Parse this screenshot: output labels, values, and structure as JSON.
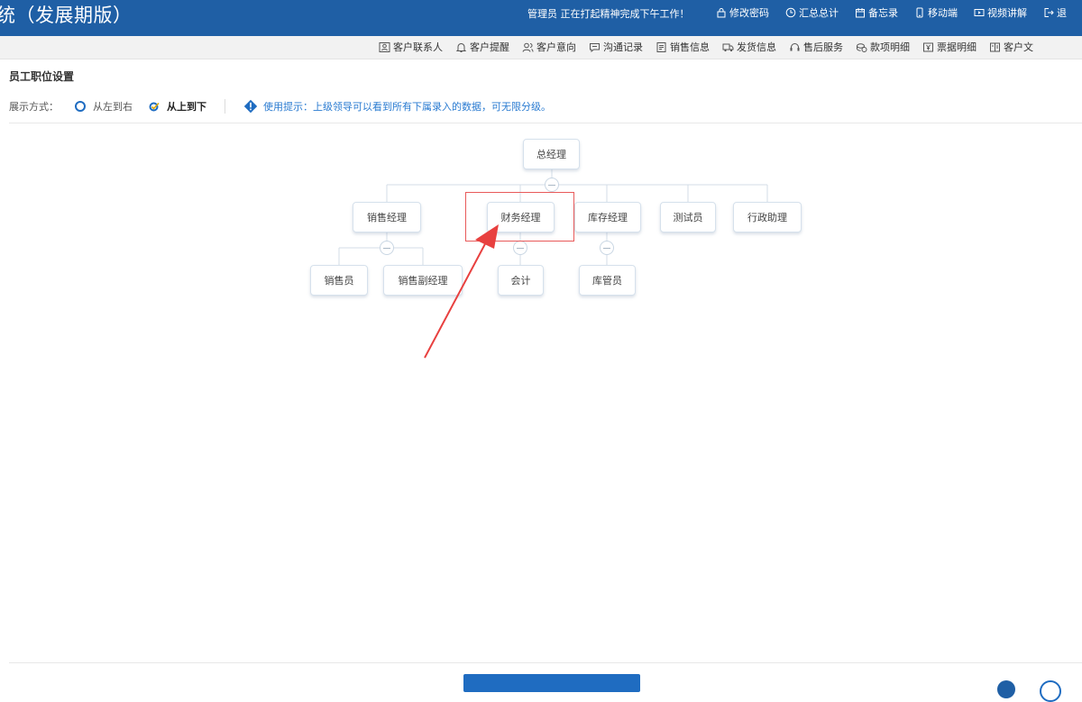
{
  "header": {
    "app_title": "统（发展期版）",
    "greeting": "管理员 正在打起精神完成下午工作！",
    "links": [
      {
        "label": "修改密码",
        "icon": "lock-icon"
      },
      {
        "label": "汇总总计",
        "icon": "clock-icon"
      },
      {
        "label": "备忘录",
        "icon": "calendar-icon"
      },
      {
        "label": "移动端",
        "icon": "mobile-icon"
      },
      {
        "label": "视频讲解",
        "icon": "video-icon"
      },
      {
        "label": "退",
        "icon": "logout-icon"
      }
    ]
  },
  "nav": {
    "items": [
      {
        "label": "客户联系人",
        "icon": "contact-card-icon"
      },
      {
        "label": "客户提醒",
        "icon": "bell-icon"
      },
      {
        "label": "客户意向",
        "icon": "users-icon"
      },
      {
        "label": "沟通记录",
        "icon": "chat-icon"
      },
      {
        "label": "销售信息",
        "icon": "document-icon"
      },
      {
        "label": "发货信息",
        "icon": "truck-icon"
      },
      {
        "label": "售后服务",
        "icon": "headset-icon"
      },
      {
        "label": "款项明细",
        "icon": "money-icon"
      },
      {
        "label": "票据明细",
        "icon": "receipt-icon"
      },
      {
        "label": "客户文",
        "icon": "file-icon"
      }
    ]
  },
  "page": {
    "title": "员工职位设置",
    "display_label": "展示方式：",
    "options": [
      {
        "label": "从左到右",
        "selected": false
      },
      {
        "label": "从上到下",
        "selected": true
      }
    ],
    "tip": "使用提示：上级领导可以看到所有下属录入的数据，可无限分级。"
  },
  "org": {
    "root": "总经理",
    "level1": [
      "销售经理",
      "财务经理",
      "库存经理",
      "测试员",
      "行政助理"
    ],
    "level2": {
      "sales": [
        "销售员",
        "销售副经理"
      ],
      "finance": [
        "会计"
      ],
      "inventory": [
        "库管员"
      ]
    }
  },
  "colors": {
    "header_bg": "#1f5fa5",
    "accent": "#1f6cc1",
    "highlight": "#e85a5a"
  }
}
